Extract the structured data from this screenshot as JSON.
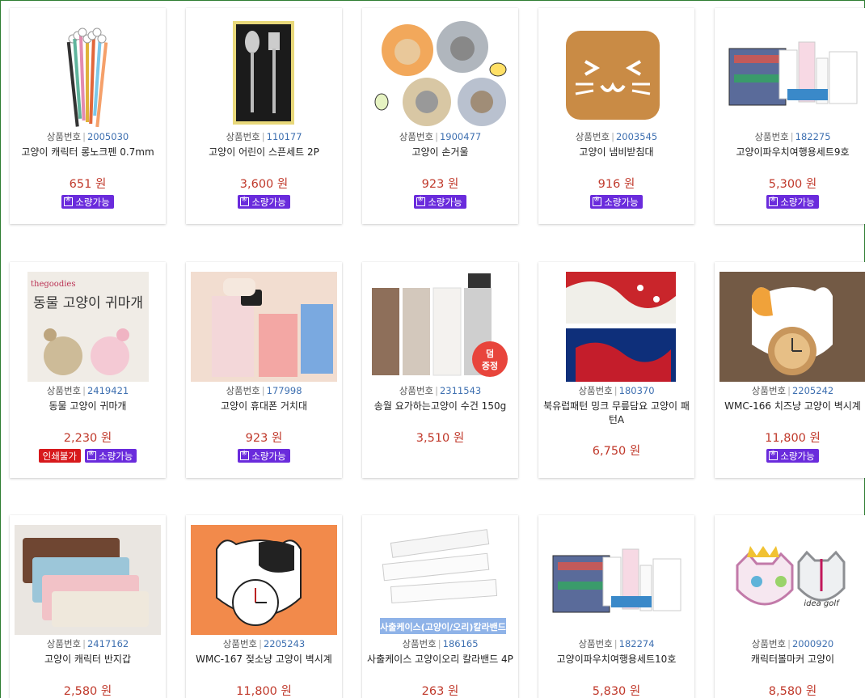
{
  "labels": {
    "code_prefix": "상품번호",
    "code_sep": "|",
    "badge_small_qty": "소량가능",
    "badge_no_print": "인쇄불가"
  },
  "products": [
    {
      "code": "2005030",
      "name": "고양이 캐릭터 롱노크펜 0.7mm",
      "price": "651 원",
      "small_qty": true,
      "no_print": false,
      "icon": "pens-image"
    },
    {
      "code": "110177",
      "name": "고양이 어린이 스픈세트 2P",
      "price": "3,600 원",
      "small_qty": true,
      "no_print": false,
      "icon": "spoon-fork-image"
    },
    {
      "code": "1900477",
      "name": "고양이 손거울",
      "price": "923 원",
      "small_qty": true,
      "no_print": false,
      "icon": "cat-mirror-image"
    },
    {
      "code": "2003545",
      "name": "고양이 냄비받침대",
      "price": "916 원",
      "small_qty": true,
      "no_print": false,
      "icon": "trivet-image"
    },
    {
      "code": "182275",
      "name": "고양이파우치여행용세트9호",
      "price": "5,300 원",
      "small_qty": true,
      "no_print": false,
      "icon": "pouch-set-image"
    },
    {
      "code": "2419421",
      "name": "동물 고양이 귀마개",
      "price": "2,230 원",
      "small_qty": true,
      "no_print": true,
      "icon": "earmuff-image",
      "img_text": "동물 고양이 귀마개",
      "img_brand": "thegoodies"
    },
    {
      "code": "177998",
      "name": "고양이 휴대폰 거치대",
      "price": "923 원",
      "small_qty": true,
      "no_print": false,
      "icon": "phone-stand-image"
    },
    {
      "code": "2311543",
      "name": "송월 요가하는고양이 수건 150g",
      "price": "3,510 원",
      "small_qty": false,
      "no_print": false,
      "icon": "towel-image",
      "img_text": "덤 증정"
    },
    {
      "code": "180370",
      "name": "북유럽패턴 밍크 무릎담요 고양이 패턴A",
      "price": "6,750 원",
      "small_qty": false,
      "no_print": false,
      "icon": "blanket-image"
    },
    {
      "code": "2205242",
      "name": "WMC-166 치즈냥 고양이 벽시계",
      "price": "11,800 원",
      "small_qty": true,
      "no_print": false,
      "icon": "clock-orange-image"
    },
    {
      "code": "2417162",
      "name": "고양이 캐릭터 반지갑",
      "price": "2,580 원",
      "small_qty": false,
      "no_print": false,
      "icon": "wallet-image"
    },
    {
      "code": "2205243",
      "name": "WMC-167 젖소냥 고양이 벽시계",
      "price": "11,800 원",
      "small_qty": false,
      "no_print": false,
      "icon": "clock-black-image"
    },
    {
      "code": "186165",
      "name": "사출케이스 고양이오리 칼라밴드 4P",
      "price": "263 원",
      "small_qty": false,
      "no_print": false,
      "icon": "bandage-image",
      "img_text": "사출케이스(고양이/오리)칼라밴드"
    },
    {
      "code": "182274",
      "name": "고양이파우치여행용세트10호",
      "price": "5,830 원",
      "small_qty": false,
      "no_print": false,
      "icon": "pouch-set-image"
    },
    {
      "code": "2000920",
      "name": "캐릭터볼마커 고양이",
      "price": "8,580 원",
      "small_qty": false,
      "no_print": false,
      "icon": "ball-marker-image",
      "img_text": "idea golf"
    }
  ],
  "colors": {
    "price": "#c0392b",
    "badge_purple": "#6a2bdc",
    "badge_red": "#d7191c",
    "code_number": "#3d6fb0",
    "frame_border": "#2e7d32"
  }
}
